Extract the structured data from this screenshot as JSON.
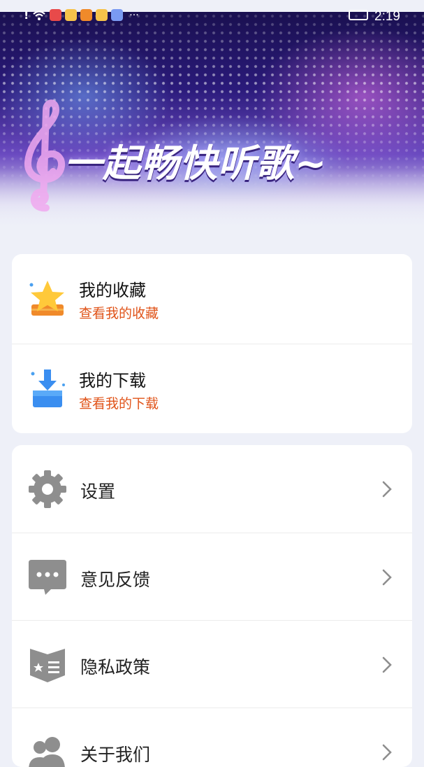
{
  "status_bar": {
    "time": "2:19",
    "more": "···"
  },
  "banner": {
    "title": "一起畅快听歌~"
  },
  "shortcuts": [
    {
      "title": "我的收藏",
      "subtitle": "查看我的收藏",
      "icon": "star-icon"
    },
    {
      "title": "我的下载",
      "subtitle": "查看我的下载",
      "icon": "download-icon"
    }
  ],
  "menu": [
    {
      "label": "设置",
      "icon": "gear-icon"
    },
    {
      "label": "意见反馈",
      "icon": "chat-icon"
    },
    {
      "label": "隐私政策",
      "icon": "shield-icon"
    },
    {
      "label": "关于我们",
      "icon": "users-icon"
    }
  ],
  "colors": {
    "accent": "#e0541a",
    "background": "#eef0f8",
    "icon_gray": "#8e8e8e"
  }
}
